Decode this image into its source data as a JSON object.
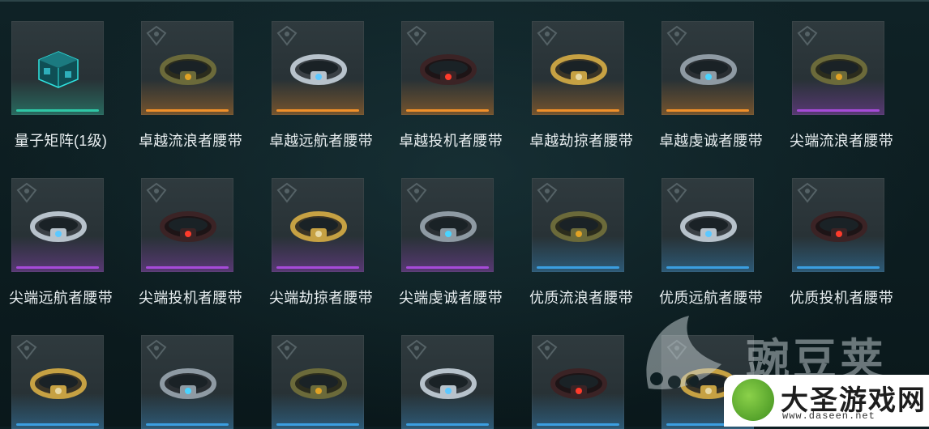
{
  "rarity_colors": {
    "orange": "#f0902a",
    "purple": "#a64bd8",
    "blue": "#3b9ee0",
    "teal": "#2fc7a6"
  },
  "items": [
    {
      "label": "量子矩阵(1级)",
      "rarity": "teal",
      "icon": "quantum-cube-icon"
    },
    {
      "label": "卓越流浪者腰带",
      "rarity": "orange",
      "icon": "belt-icon"
    },
    {
      "label": "卓越远航者腰带",
      "rarity": "orange",
      "icon": "belt-icon"
    },
    {
      "label": "卓越投机者腰带",
      "rarity": "orange",
      "icon": "belt-icon"
    },
    {
      "label": "卓越劫掠者腰带",
      "rarity": "orange",
      "icon": "belt-icon"
    },
    {
      "label": "卓越虔诚者腰带",
      "rarity": "orange",
      "icon": "belt-icon"
    },
    {
      "label": "尖端流浪者腰带",
      "rarity": "purple",
      "icon": "belt-icon"
    },
    {
      "label": "尖端远航者腰带",
      "rarity": "purple",
      "icon": "belt-icon"
    },
    {
      "label": "尖端投机者腰带",
      "rarity": "purple",
      "icon": "belt-icon"
    },
    {
      "label": "尖端劫掠者腰带",
      "rarity": "purple",
      "icon": "belt-icon"
    },
    {
      "label": "尖端虔诚者腰带",
      "rarity": "purple",
      "icon": "belt-icon"
    },
    {
      "label": "优质流浪者腰带",
      "rarity": "blue",
      "icon": "belt-icon"
    },
    {
      "label": "优质远航者腰带",
      "rarity": "blue",
      "icon": "belt-icon"
    },
    {
      "label": "优质投机者腰带",
      "rarity": "blue",
      "icon": "belt-icon"
    },
    {
      "label": "",
      "rarity": "blue",
      "icon": "belt-icon"
    },
    {
      "label": "",
      "rarity": "blue",
      "icon": "belt-icon"
    },
    {
      "label": "",
      "rarity": "blue",
      "icon": "belt-icon"
    },
    {
      "label": "",
      "rarity": "blue",
      "icon": "belt-icon"
    },
    {
      "label": "",
      "rarity": "blue",
      "icon": "belt-icon"
    },
    {
      "label": "",
      "rarity": "blue",
      "icon": "belt-icon"
    }
  ],
  "watermark": {
    "text": "豌豆荚"
  },
  "logo": {
    "title": "大圣游戏网",
    "url": "www.daseen.net"
  }
}
